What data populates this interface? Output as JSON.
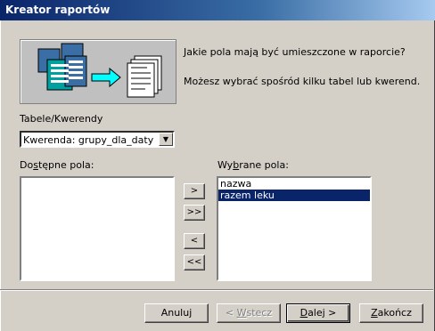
{
  "window": {
    "title": "Kreator raportów"
  },
  "intro": {
    "question": "Jakie pola mają być umieszczone w raporcie?",
    "hint": "Możesz wybrać spośród kilku tabel lub kwerend."
  },
  "source": {
    "label": "Tabele/Kwerendy",
    "selected": "Kwerenda: grupy_dla_daty"
  },
  "available": {
    "label_pre": "Do",
    "label_u": "s",
    "label_post": "tępne pola:",
    "items": []
  },
  "selected_fields": {
    "label_pre": "Wy",
    "label_u": "b",
    "label_post": "rane pola:",
    "items": [
      "nazwa",
      "razem leku"
    ],
    "selected_index": 1
  },
  "move_buttons": {
    "add_one": ">",
    "add_all": ">>",
    "remove_one": "<",
    "remove_all": "<<"
  },
  "footer": {
    "cancel": "Anuluj",
    "back_pre": "< ",
    "back_u": "W",
    "back_post": "stecz",
    "next_u": "D",
    "next_post": "alej >",
    "finish_u": "Z",
    "finish_post": "akończ"
  }
}
